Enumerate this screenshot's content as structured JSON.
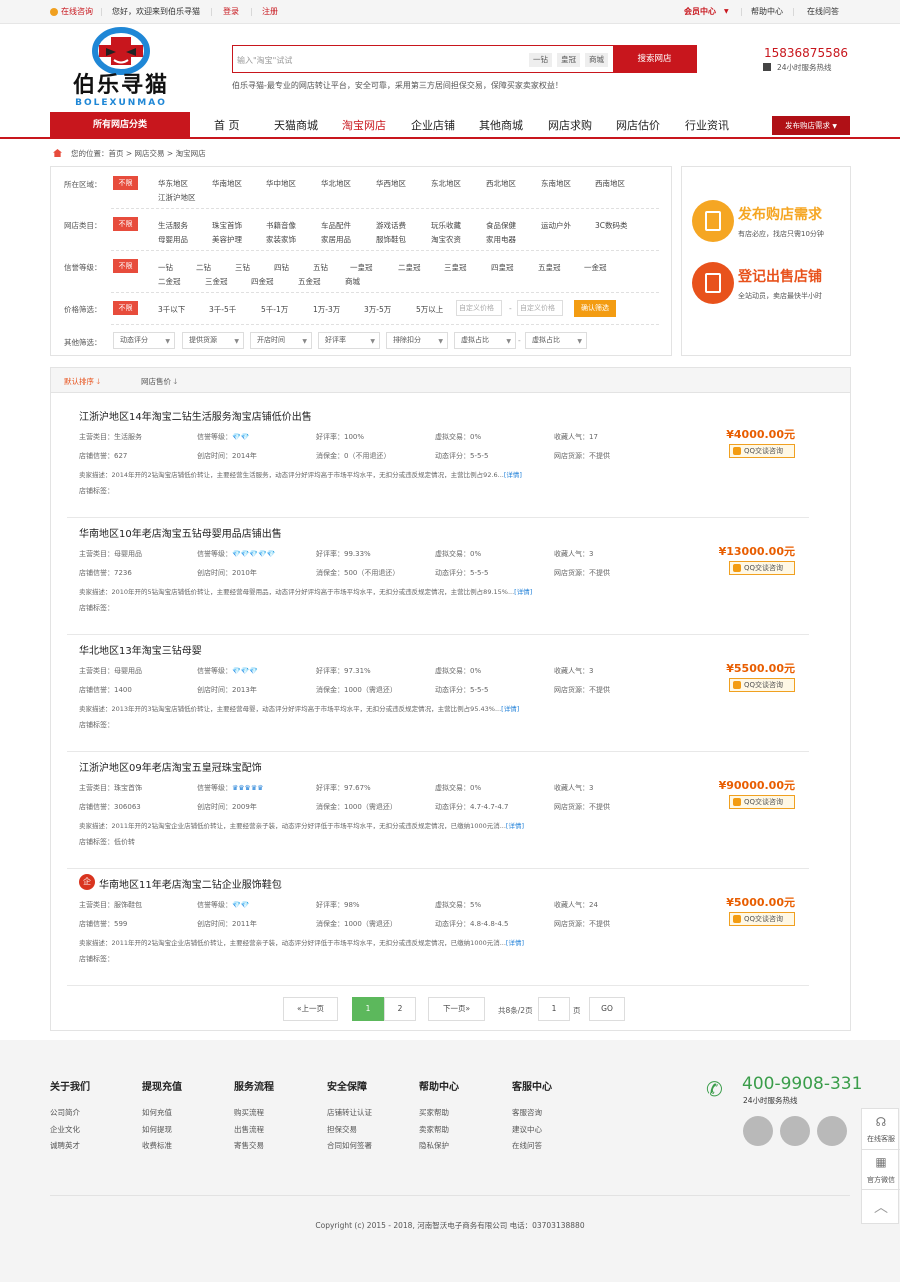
{
  "topbar": {
    "online": "在线咨询",
    "welcome": "您好，欢迎来到伯乐寻猫",
    "login": "登录",
    "register": "注册",
    "member": "会员中心",
    "help": "帮助中心",
    "ask": "在线问答"
  },
  "logo": {
    "cn": "伯乐寻猫",
    "en": "BOLEXUNMAO"
  },
  "search": {
    "placeholder": "输入\"淘宝\"试试",
    "tags": [
      "一钻",
      "皇冠",
      "商城"
    ],
    "button": "搜索网店"
  },
  "slogan": "伯乐寻猫-最专业的网店转让平台，安全可靠，采用第三方居间担保交易，保障买家卖家权益！",
  "hotline": {
    "phone": "15836875586",
    "label": "24小时服务热线"
  },
  "nav": {
    "category": "所有网店分类",
    "items": [
      "首 页",
      "天猫商城",
      "淘宝网店",
      "企业店铺",
      "其他商城",
      "网店求购",
      "网店估价",
      "行业资讯"
    ],
    "active": "淘宝网店",
    "publish": "发布购店需求"
  },
  "breadcrumb": "您的位置：首页 > 网店交易 > 淘宝网店",
  "filters": {
    "all_label": "不限",
    "region": {
      "label": "所在区域：",
      "options": [
        "华东地区",
        "华南地区",
        "华中地区",
        "华北地区",
        "华西地区",
        "东北地区",
        "西北地区",
        "东南地区",
        "西南地区",
        "江浙沪地区"
      ]
    },
    "category": {
      "label": "网店类目：",
      "options": [
        "生活服务",
        "珠宝首饰",
        "书籍音像",
        "车品配件",
        "游戏话费",
        "玩乐收藏",
        "食品保健",
        "运动户外",
        "3C数码类",
        "母婴用品",
        "美容护理",
        "家装家饰",
        "家居用品",
        "服饰鞋包",
        "淘宝农资",
        "家用电器"
      ]
    },
    "level": {
      "label": "信誉等级：",
      "options": [
        "一钻",
        "二钻",
        "三钻",
        "四钻",
        "五钻",
        "一皇冠",
        "二皇冠",
        "三皇冠",
        "四皇冠",
        "五皇冠",
        "一金冠",
        "二金冠",
        "三金冠",
        "四金冠",
        "五金冠",
        "商城"
      ]
    },
    "price": {
      "label": "价格筛选：",
      "options": [
        "3千以下",
        "3千-5千",
        "5千-1万",
        "1万-3万",
        "3万-5万",
        "5万以上"
      ],
      "min_placeholder": "自定义价格",
      "max_placeholder": "自定义价格",
      "dash": "-",
      "confirm": "确认筛选"
    },
    "other": {
      "label": "其他筛选：",
      "selects": [
        "动态评分",
        "提供货源",
        "开店时间",
        "好评率",
        "排除扣分",
        "虚拟占比",
        "虚拟占比"
      ]
    }
  },
  "side": {
    "buy": {
      "title": "发布购店需求",
      "sub": "有店必应，找店只需10分钟"
    },
    "sell": {
      "title": "登记出售店铺",
      "sub": "全站动员，卖店最快半小时"
    }
  },
  "sort": {
    "default": "默认排序",
    "price": "网店售价"
  },
  "listings": [
    {
      "title": "江浙沪地区14年淘宝二钻生活服务淘宝店铺低价出售",
      "category": "主营类目：生活服务",
      "level_label": "信誉等级：",
      "level_icons": "💎💎",
      "good": "好评率：100%",
      "virtual": "虚拟交易：0%",
      "pop": "收藏人气：17",
      "credit": "店铺信誉：627",
      "opened": "创店时间：2014年",
      "deposit": "消保金：0（不用退还）",
      "score": "动态评分：5-5-5",
      "supply": "网店货源：不提供",
      "desc": "卖家描述：2014年开的2钻淘宝店铺低价转让，主要经营生活服务，动态评分好评均高于市场平均水平，无扣分或违反规定情况，主营比例占92.6...",
      "detail": "[详情]",
      "tags": "店铺标签：",
      "price": "¥4000.00元",
      "qq": "QQ交谈咨询"
    },
    {
      "title": "华南地区10年老店淘宝五钻母婴用品店铺出售",
      "category": "主营类目：母婴用品",
      "level_label": "信誉等级：",
      "level_icons": "💎💎💎💎💎",
      "good": "好评率：99.33%",
      "virtual": "虚拟交易：0%",
      "pop": "收藏人气：3",
      "credit": "店铺信誉：7236",
      "opened": "创店时间：2010年",
      "deposit": "消保金：500（不用退还）",
      "score": "动态评分：5-5-5",
      "supply": "网店货源：不提供",
      "desc": "卖家描述：2010年开的5钻淘宝店铺低价转让，主要经营母婴用品，动态评分好评均高于市场平均水平，无扣分或违反规定情况，主营比例占89.15%...",
      "detail": "[详情]",
      "tags": "店铺标签：",
      "price": "¥13000.00元",
      "qq": "QQ交谈咨询"
    },
    {
      "title": "华北地区13年淘宝三钻母婴",
      "category": "主营类目：母婴用品",
      "level_label": "信誉等级：",
      "level_icons": "💎💎💎",
      "good": "好评率：97.31%",
      "virtual": "虚拟交易：0%",
      "pop": "收藏人气：3",
      "credit": "店铺信誉：1400",
      "opened": "创店时间：2013年",
      "deposit": "消保金：1000（需退还）",
      "score": "动态评分：5-5-5",
      "supply": "网店货源：不提供",
      "desc": "卖家描述：2013年开的3钻淘宝店铺低价转让，主要经营母婴，动态评分好评均高于市场平均水平，无扣分或违反规定情况，主营比例占95.43%...",
      "detail": "[详情]",
      "tags": "店铺标签：",
      "price": "¥5500.00元",
      "qq": "QQ交谈咨询"
    },
    {
      "title": "江浙沪地区09年老店淘宝五皇冠珠宝配饰",
      "category": "主营类目：珠宝首饰",
      "level_label": "信誉等级：",
      "level_icons": "♛♛♛♛♛",
      "good": "好评率：97.67%",
      "virtual": "虚拟交易：0%",
      "pop": "收藏人气：3",
      "credit": "店铺信誉：306063",
      "opened": "创店时间：2009年",
      "deposit": "消保金：1000（需退还）",
      "score": "动态评分：4.7-4.7-4.7",
      "supply": "网店货源：不提供",
      "desc": "卖家描述：2011年开的2钻淘宝企业店铺低价转让，主要经营亲子装，动态评分好评低于市场平均水平，无扣分或违反规定情况，已缴纳1000元消...",
      "detail": "[详情]",
      "tags": "店铺标签：低价转",
      "price": "¥90000.00元",
      "qq": "QQ交谈咨询"
    },
    {
      "title": "华南地区11年老店淘宝二钻企业服饰鞋包",
      "category": "主营类目：服饰鞋包",
      "level_label": "信誉等级：",
      "level_icons": "💎💎",
      "good": "好评率：98%",
      "virtual": "虚拟交易：5%",
      "pop": "收藏人气：24",
      "credit": "店铺信誉：599",
      "opened": "创店时间：2011年",
      "deposit": "消保金：1000（需退还）",
      "score": "动态评分：4.8-4.8-4.5",
      "supply": "网店货源：不提供",
      "desc": "卖家描述：2011年开的2钻淘宝企业店铺低价转让，主要经营亲子装，动态评分好评低于市场平均水平，无扣分或违反规定情况，已缴纳1000元消...",
      "detail": "[详情]",
      "tags": "店铺标签：",
      "price": "¥5000.00元",
      "qq": "QQ交谈咨询",
      "enterprise_badge": "企"
    }
  ],
  "pager": {
    "prev": "«上一页",
    "pages": [
      "1",
      "2"
    ],
    "current": "1",
    "next": "下一页»",
    "total": "共8条/2页",
    "input": "1",
    "page_unit": "页",
    "go": "GO"
  },
  "footer": {
    "columns": [
      {
        "title": "关于我们",
        "links": [
          "公司简介",
          "企业文化",
          "诚聘英才"
        ]
      },
      {
        "title": "提现充值",
        "links": [
          "如何充值",
          "如何提现",
          "收费标准"
        ]
      },
      {
        "title": "服务流程",
        "links": [
          "购买流程",
          "出售流程",
          "寄售交易"
        ]
      },
      {
        "title": "安全保障",
        "links": [
          "店铺转让认证",
          "担保交易",
          "合同如何签署"
        ]
      },
      {
        "title": "帮助中心",
        "links": [
          "买家帮助",
          "卖家帮助",
          "隐私保护"
        ]
      },
      {
        "title": "客服中心",
        "links": [
          "客服咨询",
          "建议中心",
          "在线问答"
        ]
      }
    ],
    "phone": "400-9908-331",
    "phone_label": "24小时服务热线",
    "copyright": "Copyright (c) 2015 - 2018, 河南智沃电子商务有限公司 电话：03703138880"
  },
  "float": {
    "service": "在线客服",
    "wechat": "官方微信"
  },
  "colors": {
    "brand": "#c8161d",
    "price": "#e85d00",
    "accent": "#f39c12",
    "green": "#3a9d4a"
  }
}
